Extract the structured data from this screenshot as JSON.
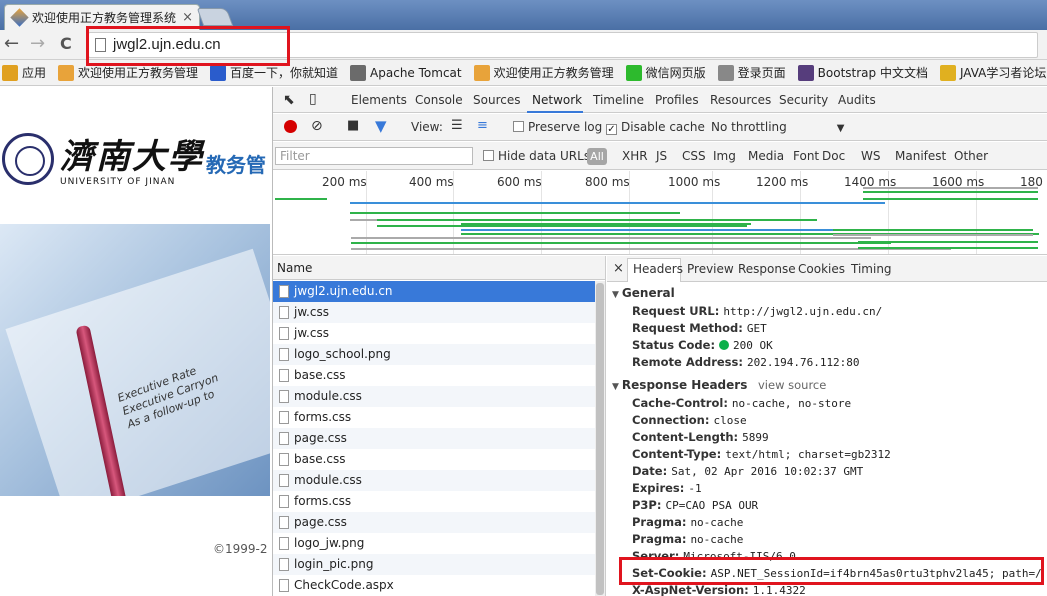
{
  "browser": {
    "tab_title": "欢迎使用正方教务管理系统",
    "tab_close": "×",
    "url": "jwgl2.ujn.edu.cn",
    "nav": {
      "back": "←",
      "forward": "→",
      "reload": "C"
    }
  },
  "bookmarks": [
    {
      "label": "应用",
      "icon": "apps-icon",
      "color": "#e0a020"
    },
    {
      "label": "欢迎使用正方教务管理",
      "icon": "zf-cube-icon",
      "color": "#e8a33a"
    },
    {
      "label": "百度一下，你就知道",
      "icon": "baidu-icon",
      "color": "#2a5ccc"
    },
    {
      "label": "Apache Tomcat",
      "icon": "tomcat-icon",
      "color": "#6b6b6b"
    },
    {
      "label": "欢迎使用正方教务管理",
      "icon": "zf-cube-icon",
      "color": "#e8a33a"
    },
    {
      "label": "微信网页版",
      "icon": "wechat-icon",
      "color": "#2dba2d"
    },
    {
      "label": "登录页面",
      "icon": "login-page-icon",
      "color": "#888888"
    },
    {
      "label": "Bootstrap 中文文档",
      "icon": "bootstrap-icon",
      "color": "#563d7c"
    },
    {
      "label": "JAVA学习者论坛",
      "icon": "trophy-icon",
      "color": "#e0b020"
    }
  ],
  "page": {
    "university_cn": "濟南大學",
    "university_en": "UNIVERSITY OF JINAN",
    "system_title": "教务管",
    "hero_text": "Executive Rate\nExecutive Carryon\nAs a follow-up to",
    "copyright": "©1999-2"
  },
  "devtools": {
    "tabs": [
      "Elements",
      "Console",
      "Sources",
      "Network",
      "Timeline",
      "Profiles",
      "Resources",
      "Security",
      "Audits"
    ],
    "active_tab": "Network",
    "controls": {
      "view_label": "View:",
      "preserve_log": "Preserve log",
      "preserve_log_checked": false,
      "disable_cache": "Disable cache",
      "disable_cache_checked": true,
      "throttling": "No throttling"
    },
    "filter": {
      "placeholder": "Filter",
      "hide_data_urls": "Hide data URLs",
      "hide_data_urls_checked": false,
      "all": "All",
      "types": [
        "XHR",
        "JS",
        "CSS",
        "Img",
        "Media",
        "Font",
        "Doc",
        "WS",
        "Manifest",
        "Other"
      ]
    },
    "timeline_ticks": [
      "200 ms",
      "400 ms",
      "600 ms",
      "800 ms",
      "1000 ms",
      "1200 ms",
      "1400 ms",
      "1600 ms",
      "180"
    ],
    "requests": {
      "header": "Name",
      "rows": [
        "jwgl2.ujn.edu.cn",
        "jw.css",
        "jw.css",
        "logo_school.png",
        "base.css",
        "module.css",
        "forms.css",
        "page.css",
        "base.css",
        "module.css",
        "forms.css",
        "page.css",
        "logo_jw.png",
        "login_pic.png",
        "CheckCode.aspx"
      ],
      "selected_index": 0
    },
    "detail": {
      "close": "×",
      "tabs": [
        "Headers",
        "Preview",
        "Response",
        "Cookies",
        "Timing"
      ],
      "active_tab": "Headers",
      "general_title": "General",
      "general": [
        {
          "k": "Request URL:",
          "v": "http://jwgl2.ujn.edu.cn/"
        },
        {
          "k": "Request Method:",
          "v": "GET"
        },
        {
          "k": "Status Code:",
          "v": "200 OK"
        },
        {
          "k": "Remote Address:",
          "v": "202.194.76.112:80"
        }
      ],
      "response_title": "Response Headers",
      "view_source": "view source",
      "response": [
        {
          "k": "Cache-Control:",
          "v": "no-cache, no-store"
        },
        {
          "k": "Connection:",
          "v": "close"
        },
        {
          "k": "Content-Length:",
          "v": "5899"
        },
        {
          "k": "Content-Type:",
          "v": "text/html; charset=gb2312"
        },
        {
          "k": "Date:",
          "v": "Sat, 02 Apr 2016 10:02:37 GMT"
        },
        {
          "k": "Expires:",
          "v": "-1"
        },
        {
          "k": "P3P:",
          "v": "CP=CAO PSA OUR"
        },
        {
          "k": "Pragma:",
          "v": "no-cache"
        },
        {
          "k": "Pragma:",
          "v": "no-cache"
        },
        {
          "k": "Server:",
          "v": "Microsoft-IIS/6.0"
        },
        {
          "k": "Set-Cookie:",
          "v": "ASP.NET_SessionId=if4brn45as0rtu3tphv2la45; path=/"
        },
        {
          "k": "X-AspNet-Version:",
          "v": "1.1.4322"
        }
      ]
    }
  },
  "colors": {
    "highlight": "#e0141e",
    "accent": "#3879d9",
    "status_ok": "#0cb04a"
  }
}
